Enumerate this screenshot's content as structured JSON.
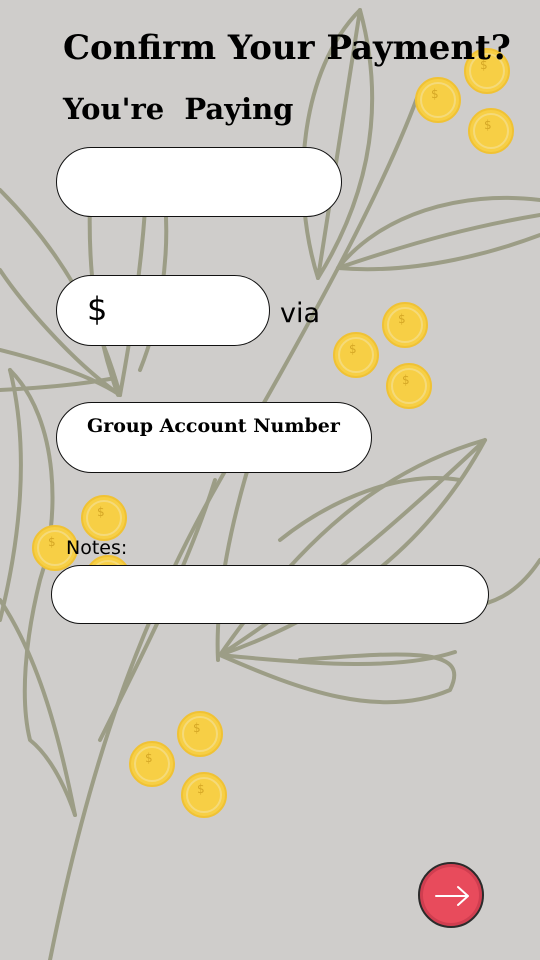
{
  "header": {
    "title": "Confirm Your Payment?",
    "subtitle": "You're  Paying"
  },
  "form": {
    "recipient_value": "",
    "currency_symbol": "$",
    "amount_value": "",
    "via_label": "via",
    "account_label": "Group Account Number",
    "notes_label": "Notes:",
    "notes_value": ""
  },
  "icons": {
    "next_button": "arrow-right-icon",
    "decoration": "gold-coin-icon"
  },
  "colors": {
    "background": "#cfcdcb",
    "leaf_outline": "#9c9d86",
    "coin": "#f7cf45",
    "next_button": "#e84b5c"
  }
}
